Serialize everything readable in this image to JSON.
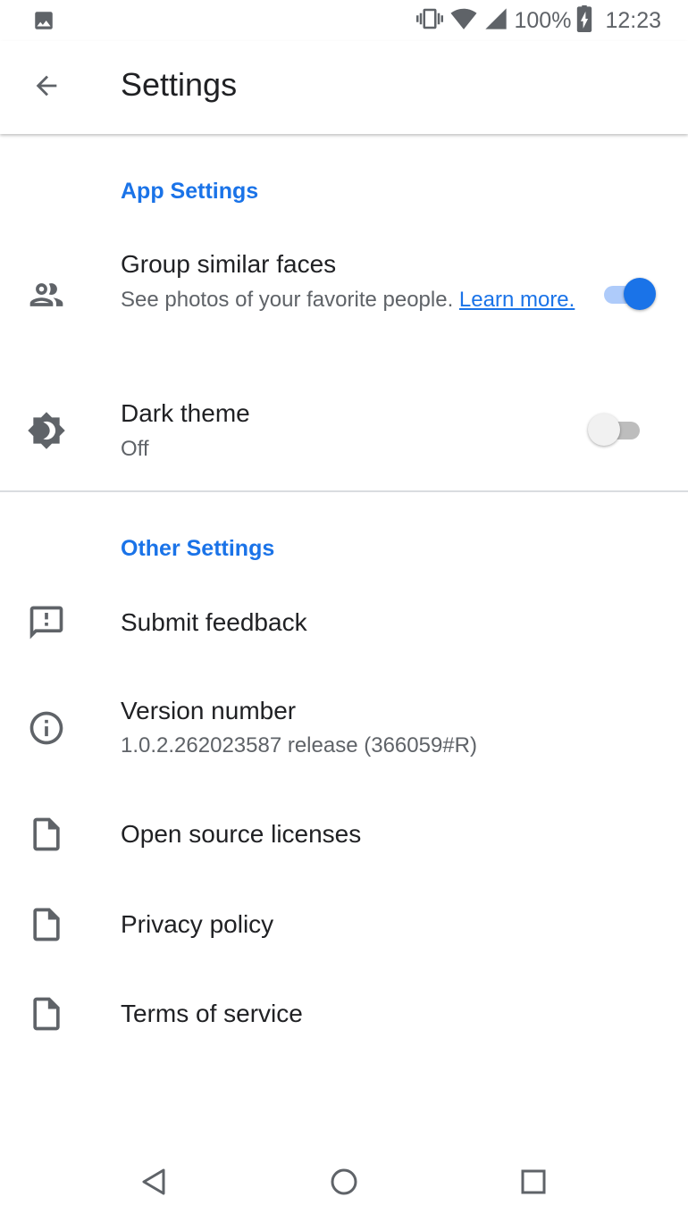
{
  "status_bar": {
    "notification_icon": "image-icon",
    "vibrate_icon": "vibrate-icon",
    "wifi_icon": "wifi-icon",
    "signal_icon": "cell-signal-icon",
    "battery_icon": "battery-charging-icon",
    "battery_text": "100%",
    "time": "12:23"
  },
  "app_bar": {
    "back_icon": "arrow-back-icon",
    "title": "Settings"
  },
  "sections": {
    "app_settings": {
      "header": "App Settings",
      "group_faces": {
        "icon": "people-icon",
        "title": "Group similar faces",
        "subtitle": "See photos of your favorite people. ",
        "link": "Learn more.",
        "enabled": true
      },
      "dark_theme": {
        "icon": "brightness-icon",
        "title": "Dark theme",
        "subtitle": "Off",
        "enabled": false
      }
    },
    "other_settings": {
      "header": "Other Settings",
      "feedback": {
        "icon": "feedback-icon",
        "title": "Submit feedback"
      },
      "version": {
        "icon": "info-icon",
        "title": "Version number",
        "subtitle": "1.0.2.262023587 release (366059#R)"
      },
      "licenses": {
        "icon": "document-icon",
        "title": "Open source licenses"
      },
      "privacy": {
        "icon": "document-icon",
        "title": "Privacy policy"
      },
      "terms": {
        "icon": "document-icon",
        "title": "Terms of service"
      }
    }
  },
  "nav_bar": {
    "back_icon": "nav-back-icon",
    "home_icon": "nav-home-icon",
    "recents_icon": "nav-recents-icon"
  },
  "colors": {
    "accent": "#1a73e8",
    "primary_text": "#202124",
    "secondary_text": "#5f6368",
    "divider": "#dadce0"
  }
}
